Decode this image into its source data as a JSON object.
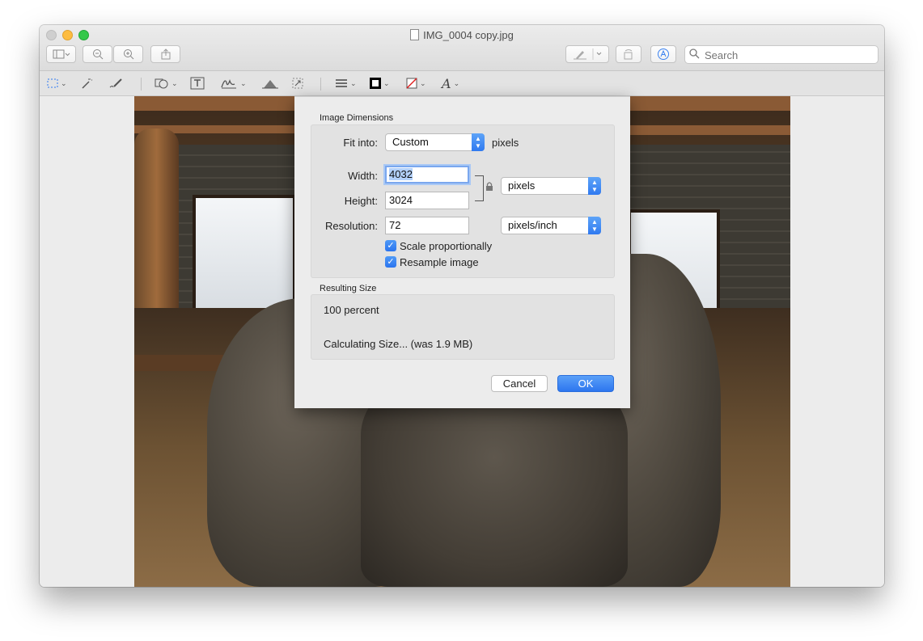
{
  "window": {
    "title": "IMG_0004 copy.jpg",
    "toolbar": {
      "search_placeholder": "Search"
    }
  },
  "dialog": {
    "image_dimensions_label": "Image Dimensions",
    "fit_into_label": "Fit into:",
    "fit_into_value": "Custom",
    "fit_into_unit": "pixels",
    "width_label": "Width:",
    "width_value": "4032",
    "height_label": "Height:",
    "height_value": "3024",
    "size_unit": "pixels",
    "resolution_label": "Resolution:",
    "resolution_value": "72",
    "resolution_unit": "pixels/inch",
    "scale_proportionally_label": "Scale proportionally",
    "scale_proportionally_checked": true,
    "resample_image_label": "Resample image",
    "resample_image_checked": true,
    "resulting_size_label": "Resulting Size",
    "percent_text": "100 percent",
    "size_text": "Calculating Size... (was 1.9 MB)",
    "cancel_label": "Cancel",
    "ok_label": "OK"
  },
  "colors": {
    "accent": "#2f79f0",
    "window_bg": "#ececec"
  }
}
